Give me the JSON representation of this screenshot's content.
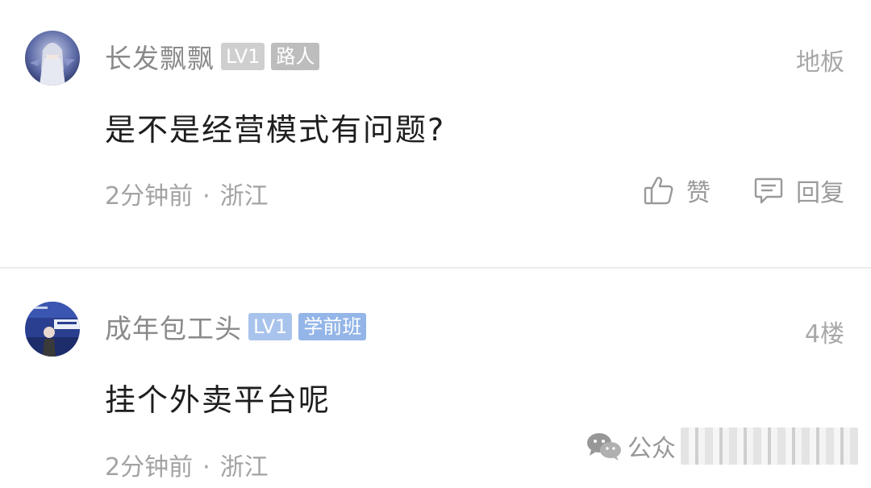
{
  "comments": [
    {
      "username": "长发飘飘",
      "level_badge": "LV1",
      "rank_badge": "路人",
      "floor": "地板",
      "content": "是不是经营模式有问题?",
      "time": "2分钟前",
      "separator": "·",
      "location": "浙江",
      "like_label": "赞",
      "reply_label": "回复"
    },
    {
      "username": "成年包工头",
      "level_badge": "LV1",
      "rank_badge": "学前班",
      "floor": "4楼",
      "content": "挂个外卖平台呢",
      "time": "2分钟前",
      "separator": "·",
      "location": "浙江"
    }
  ],
  "watermark": {
    "text": "公众"
  },
  "icons": {
    "like": "thumbs-up-icon",
    "reply": "comment-bubble-icon",
    "watermark": "wechat-icon"
  },
  "colors": {
    "badge_gray": "#cfcfcf",
    "badge_blue": "#a9c4ec",
    "text_secondary": "#a3a3a3"
  }
}
